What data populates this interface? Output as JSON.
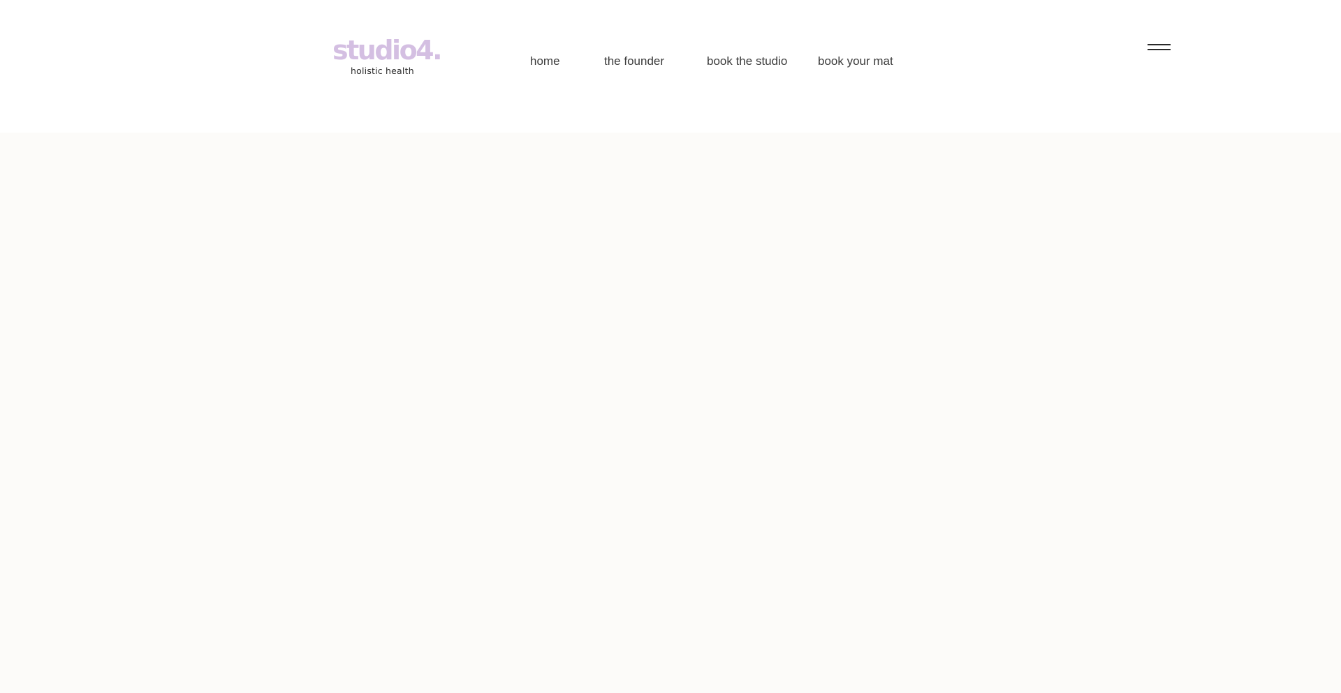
{
  "site": {
    "logo": {
      "wordmark": "studio4.",
      "tagline": "holistic health",
      "wordmark_color": "#d4bfe2",
      "tagline_color": "#2b2b2b"
    },
    "nav": {
      "items": [
        {
          "label": "home"
        },
        {
          "label": "the founder"
        },
        {
          "label": "book the studio"
        },
        {
          "label": "book your mat"
        }
      ]
    },
    "menu": {
      "icon": "hamburger-menu-icon"
    },
    "colors": {
      "header_bg": "#ffffff",
      "hero_bg": "#fcfbf9",
      "nav_text": "#3a3a3a"
    }
  }
}
